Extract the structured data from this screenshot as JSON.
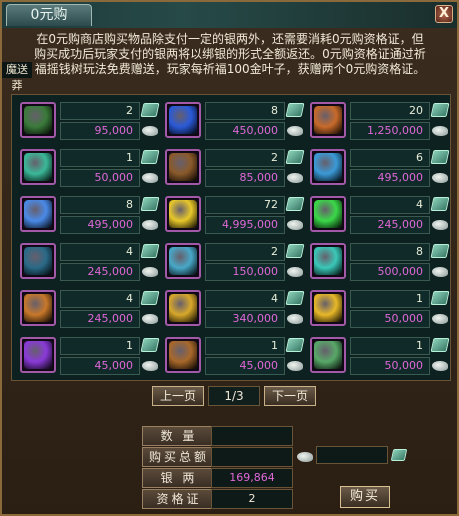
{
  "window": {
    "title": "0元购",
    "close_label": "X"
  },
  "side_tab": "魔送莽",
  "notice": [
    "在0元购商店购买物品除支付一定的银两外，还需要消耗0元购资格证，但",
    "购买成功后玩家支付的银两将以绑银的形式全额返还。0元购资格证通过祈",
    "福摇钱树玩法免费赠送，玩家每祈福100金叶子，获赠两个0元购资格证。"
  ],
  "items": [
    {
      "qty": "2",
      "price": "95,000",
      "art": "book",
      "color": "#3a7a3a"
    },
    {
      "qty": "8",
      "price": "450,000",
      "art": "blue-gem",
      "color": "#2a5ad8"
    },
    {
      "qty": "20",
      "price": "1,250,000",
      "art": "scroll",
      "color": "#c86a2a"
    },
    {
      "qty": "1",
      "price": "50,000",
      "art": "serpent",
      "color": "#3ab898"
    },
    {
      "qty": "2",
      "price": "85,000",
      "art": "chest",
      "color": "#8a5a2a"
    },
    {
      "qty": "6",
      "price": "495,000",
      "art": "orb",
      "color": "#3a9ad8"
    },
    {
      "qty": "8",
      "price": "495,000",
      "art": "blue-orb",
      "color": "#4a8ae8"
    },
    {
      "qty": "72",
      "price": "4,995,000",
      "art": "sun-orb",
      "color": "#e8c82a"
    },
    {
      "qty": "4",
      "price": "245,000",
      "art": "green-pearl",
      "color": "#3ad848"
    },
    {
      "qty": "4",
      "price": "245,000",
      "art": "dark-orb",
      "color": "#2a6a88"
    },
    {
      "qty": "2",
      "price": "150,000",
      "art": "gem-pile",
      "color": "#48a8c8"
    },
    {
      "qty": "8",
      "price": "500,000",
      "art": "teal-orb",
      "color": "#3ac8b8"
    },
    {
      "qty": "4",
      "price": "245,000",
      "art": "amulet",
      "color": "#c8782a"
    },
    {
      "qty": "4",
      "price": "340,000",
      "art": "fan",
      "color": "#d8a82a"
    },
    {
      "qty": "1",
      "price": "50,000",
      "art": "gold-ingot",
      "color": "#e8b828"
    },
    {
      "qty": "1",
      "price": "45,000",
      "art": "purple-scroll",
      "color": "#8a3ad8"
    },
    {
      "qty": "1",
      "price": "45,000",
      "art": "crescent",
      "color": "#a8682a"
    },
    {
      "qty": "1",
      "price": "50,000",
      "art": "money-bag",
      "color": "#58a868"
    }
  ],
  "pager": {
    "prev_label": "上一页",
    "page": "1/3",
    "next_label": "下一页"
  },
  "form": {
    "qty_label": "数 量",
    "qty_value": "",
    "total_label": "购买总额",
    "total_value": "",
    "silver_label": "银 两",
    "silver_value": "169,864",
    "cert_label": "资格证",
    "cert_value": "2",
    "buy_label": "购买"
  },
  "colors": {
    "price": "#e068d8",
    "silver": "#e068d8",
    "cert": "#f0e8d8",
    "slot_border": "#a25aa8"
  },
  "icons": {
    "price_currency": "silver-ingot-icon",
    "cert_currency": "ticket-icon"
  }
}
